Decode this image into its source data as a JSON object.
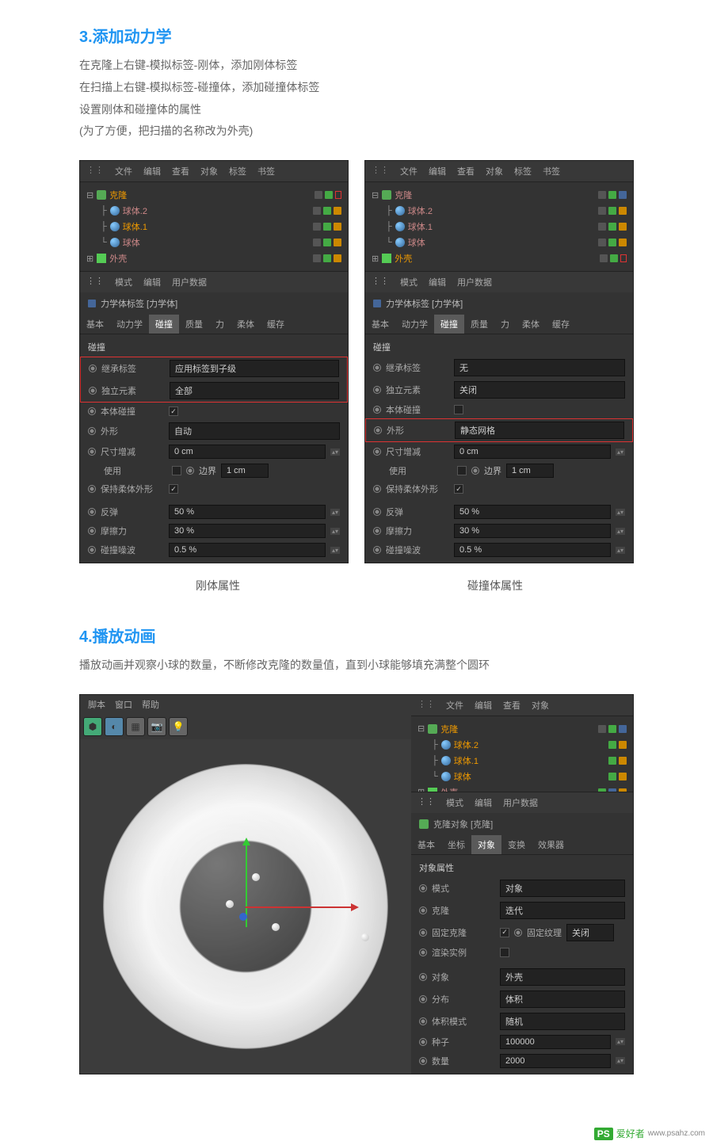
{
  "section3": {
    "title": "3.添加动力学",
    "desc1": "在克隆上右键-模拟标签-刚体，添加刚体标签",
    "desc2": "在扫描上右键-模拟标签-碰撞体，添加碰撞体标签",
    "desc3": "设置刚体和碰撞体的属性",
    "desc4": "(为了方便，把扫描的名称改为外壳)"
  },
  "menubar": {
    "grip": "⋮⋮",
    "file": "文件",
    "edit": "编辑",
    "view": "查看",
    "object": "对象",
    "tags": "标签",
    "bookmark": "书签"
  },
  "tree": {
    "clone": "克隆",
    "sphere2": "球体.2",
    "sphere1": "球体.1",
    "sphere": "球体",
    "shell": "外壳"
  },
  "attr_menu": {
    "grip": "⋮⋮",
    "mode": "模式",
    "edit": "编辑",
    "userdata": "用户数据"
  },
  "attr_title": "力学体标签 [力学体]",
  "tabs": {
    "basic": "基本",
    "dynamics": "动力学",
    "collision": "碰撞",
    "mass": "质量",
    "force": "力",
    "soft": "柔体",
    "cache": "缓存"
  },
  "props": {
    "collision_header": "碰撞",
    "inherit": "继承标签",
    "inherit_v1": "应用标签到子级",
    "inherit_v2": "无",
    "indep": "独立元素",
    "indep_v1": "全部",
    "indep_v2": "关闭",
    "selfcol": "本体碰撞",
    "shape": "外形",
    "shape_v1": "自动",
    "shape_v2": "静态网格",
    "sizeinc": "尺寸增减",
    "sizeinc_v": "0 cm",
    "use": "使用",
    "boundary": "边界",
    "boundary_v": "1 cm",
    "keepsoft": "保持柔体外形",
    "bounce": "反弹",
    "bounce_v": "50 %",
    "friction": "摩擦力",
    "friction_v": "30 %",
    "noise": "碰撞噪波",
    "noise_v": "0.5 %"
  },
  "captions": {
    "left": "刚体属性",
    "right": "碰撞体属性"
  },
  "section4": {
    "title": "4.播放动画",
    "desc": "播放动画并观察小球的数量，不断修改克隆的数量值，直到小球能够填充满整个圆环"
  },
  "vp_menu": {
    "script": "脚本",
    "window": "窗口",
    "help": "帮助"
  },
  "vp_tree_menu": {
    "grip": "⋮⋮",
    "file": "文件",
    "edit": "编辑",
    "view": "查看",
    "obj": "对象"
  },
  "clone_title": "克隆对象 [克隆]",
  "clone_tabs": {
    "basic": "基本",
    "coord": "坐标",
    "object": "对象",
    "transform": "变换",
    "effector": "效果器"
  },
  "clone_props": {
    "header": "对象属性",
    "mode": "模式",
    "mode_v": "对象",
    "clone": "克隆",
    "clone_v": "迭代",
    "fixclone": "固定克隆",
    "fixtex": "固定纹理",
    "fixtex_v": "关闭",
    "render": "渲染实例",
    "object": "对象",
    "object_v": "外壳",
    "dist": "分布",
    "dist_v": "体积",
    "volmode": "体积模式",
    "volmode_v": "随机",
    "seed": "种子",
    "seed_v": "100000",
    "count": "数量",
    "count_v": "2000"
  },
  "watermark": {
    "ps": "PS",
    "text": "爱好者",
    "url": "www.psahz.com"
  }
}
